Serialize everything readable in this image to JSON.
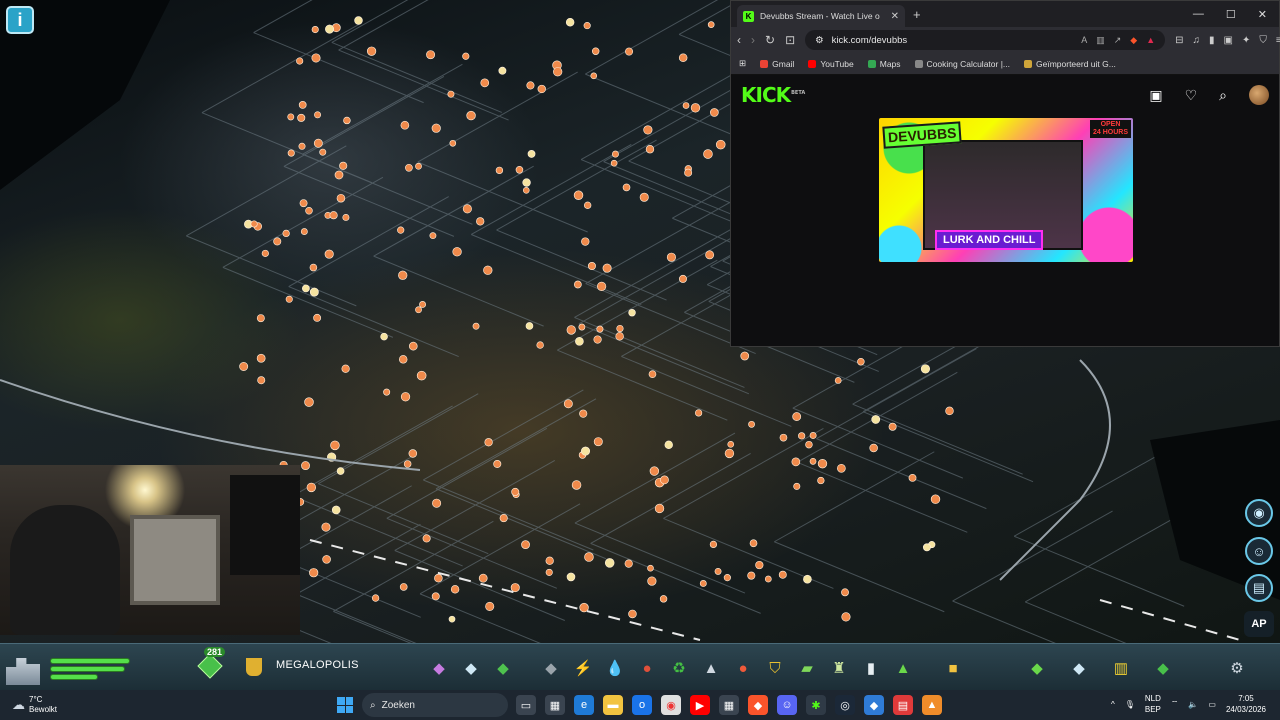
{
  "browser": {
    "tab_title": "Devubbs Stream - Watch Live o",
    "url": "kick.com/devubbs",
    "bookmarks": [
      {
        "label": "Gmail",
        "color": "#ea4335"
      },
      {
        "label": "YouTube",
        "color": "#ff0000"
      },
      {
        "label": "Maps",
        "color": "#34a853"
      },
      {
        "label": "Cooking Calculator |...",
        "color": "#888888"
      },
      {
        "label": "Geïmporteerd uit G...",
        "color": "#cfa53a"
      }
    ]
  },
  "kick": {
    "logo": "KICK",
    "logo_sup": "BETA",
    "thumbnail": {
      "brand": "DEVUBBS",
      "open_line1": "OPEN",
      "open_line2": "24 HOURS",
      "caption": "LURK AND CHILL"
    }
  },
  "game": {
    "level": "281",
    "city_name": "MEGALOPOLIS",
    "ap_label": "AP"
  },
  "taskbar": {
    "temperature": "7°C",
    "weather": "Bewolkt",
    "search_placeholder": "Zoeken",
    "lang1": "NLD",
    "lang2": "BEP",
    "time": "7:05",
    "date": "24/03/2026"
  },
  "colors": {
    "kick_green": "#53fc18",
    "toolbar_bg": "#1c2e36",
    "taskbar_bg": "#1d2630"
  }
}
